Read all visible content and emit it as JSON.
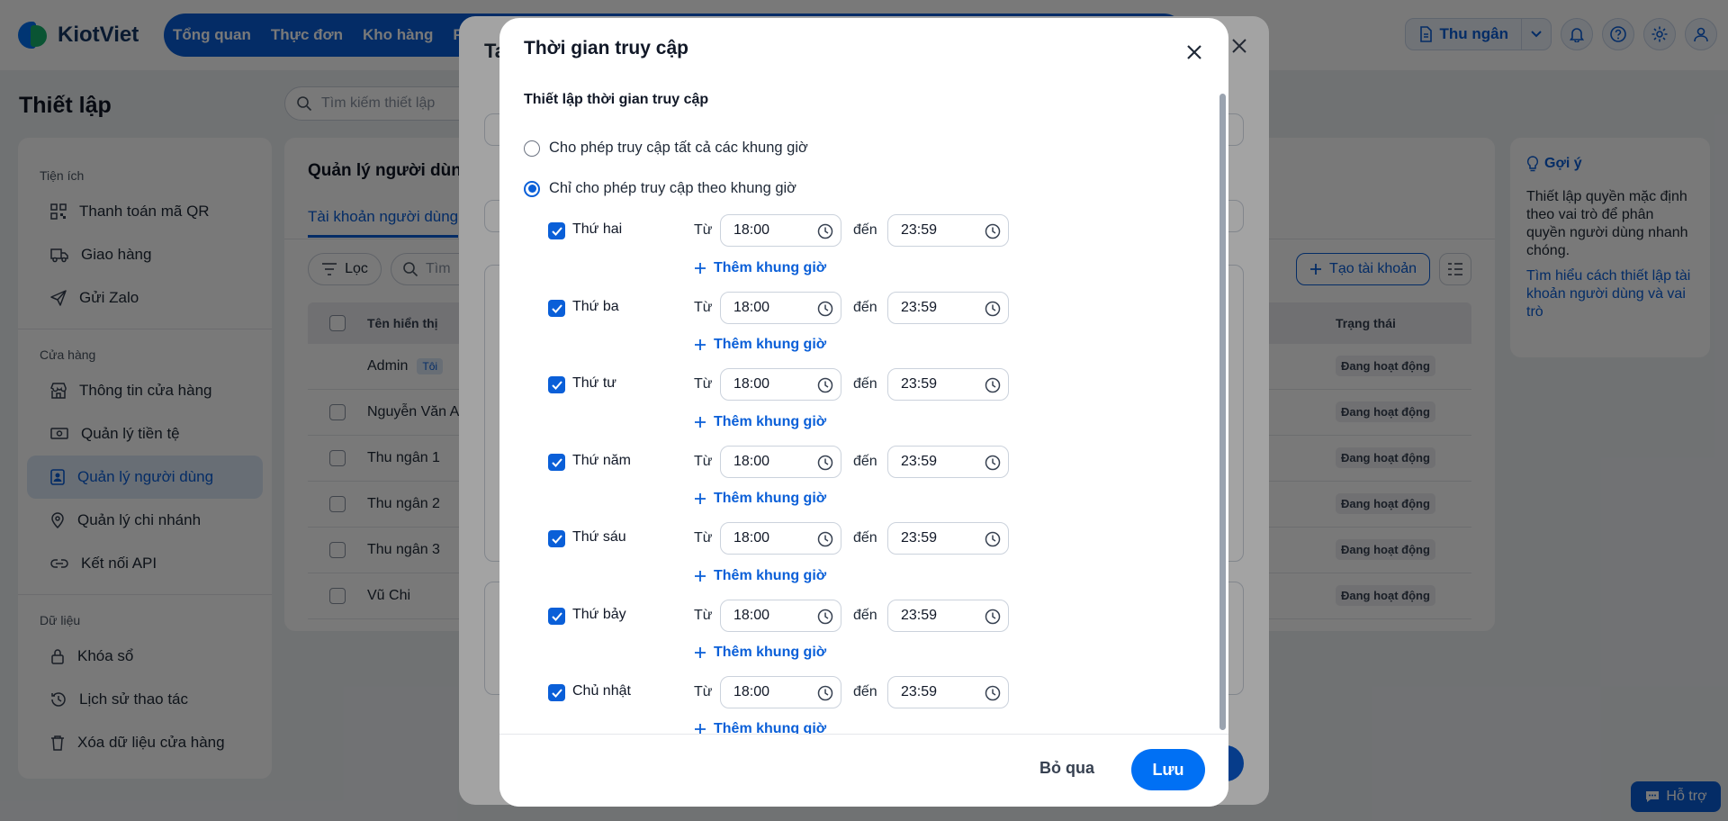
{
  "header": {
    "brand": "KiotViet",
    "nav": [
      "Tổng quan",
      "Thực đơn",
      "Kho hàng",
      "Phò"
    ],
    "cashier_label": "Thu ngân"
  },
  "page": {
    "title": "Thiết lập",
    "search_placeholder": "Tìm kiếm thiết lập"
  },
  "sidebar": {
    "sections": [
      {
        "title": "Tiện ích",
        "items": [
          "Thanh toán mã QR",
          "Giao hàng",
          "Gửi Zalo"
        ]
      },
      {
        "title": "Cửa hàng",
        "items": [
          "Thông tin cửa hàng",
          "Quản lý tiền tệ",
          "Quản lý người dùng",
          "Quản lý chi nhánh",
          "Kết nối API"
        ]
      },
      {
        "title": "Dữ liệu",
        "items": [
          "Khóa sổ",
          "Lịch sử thao tác",
          "Xóa dữ liệu cửa hàng"
        ]
      }
    ],
    "active_item": "Quản lý người dùng"
  },
  "users": {
    "title": "Quản lý người dùng",
    "tab": "Tài khoản người dùng",
    "filter_label": "Lọc",
    "search_placeholder": "Tìm",
    "create_label": "Tạo tài khoản",
    "columns": {
      "name": "Tên hiển thị",
      "status": "Trạng thái"
    },
    "me_badge": "Tôi",
    "rows": [
      {
        "name": "Admin",
        "status": "Đang hoạt động"
      },
      {
        "name": "Nguyễn Văn A",
        "status": "Đang hoạt động"
      },
      {
        "name": "Thu ngân 1",
        "status": "Đang hoạt động"
      },
      {
        "name": "Thu ngân 2",
        "status": "Đang hoạt động"
      },
      {
        "name": "Thu ngân 3",
        "status": "Đang hoạt động"
      },
      {
        "name": "Vũ Chi",
        "status": "Đang hoạt động"
      }
    ]
  },
  "hint": {
    "title": "Gợi ý",
    "text": "Thiết lập quyền mặc định theo vai trò để phân quyền người dùng nhanh chóng.",
    "link": "Tìm hiểu cách thiết lập tài khoản người dùng và vai trò"
  },
  "support_label": "Hỗ trợ",
  "behind_panel": {
    "title_fragment": "Ta"
  },
  "modal": {
    "title": "Thời gian truy cập",
    "section_title": "Thiết lập thời gian truy cập",
    "option_all": "Cho phép truy cập tất cả các khung giờ",
    "option_limited": "Chỉ cho phép truy cập theo khung giờ",
    "selected_option": "limited",
    "from_label": "Từ",
    "to_label": "đến",
    "add_slot_label": "Thêm khung giờ",
    "days": [
      {
        "name": "Thứ hai",
        "checked": true,
        "from": "18:00",
        "to": "23:59"
      },
      {
        "name": "Thứ ba",
        "checked": true,
        "from": "18:00",
        "to": "23:59"
      },
      {
        "name": "Thứ tư",
        "checked": true,
        "from": "18:00",
        "to": "23:59"
      },
      {
        "name": "Thứ năm",
        "checked": true,
        "from": "18:00",
        "to": "23:59"
      },
      {
        "name": "Thứ sáu",
        "checked": true,
        "from": "18:00",
        "to": "23:59"
      },
      {
        "name": "Thứ bảy",
        "checked": true,
        "from": "18:00",
        "to": "23:59"
      },
      {
        "name": "Chủ nhật",
        "checked": true,
        "from": "18:00",
        "to": "23:59"
      }
    ],
    "skip_label": "Bỏ qua",
    "save_label": "Lưu"
  },
  "colors": {
    "primary": "#0a5fd8",
    "accent": "#0070f4",
    "brand_green": "#16b36e"
  }
}
